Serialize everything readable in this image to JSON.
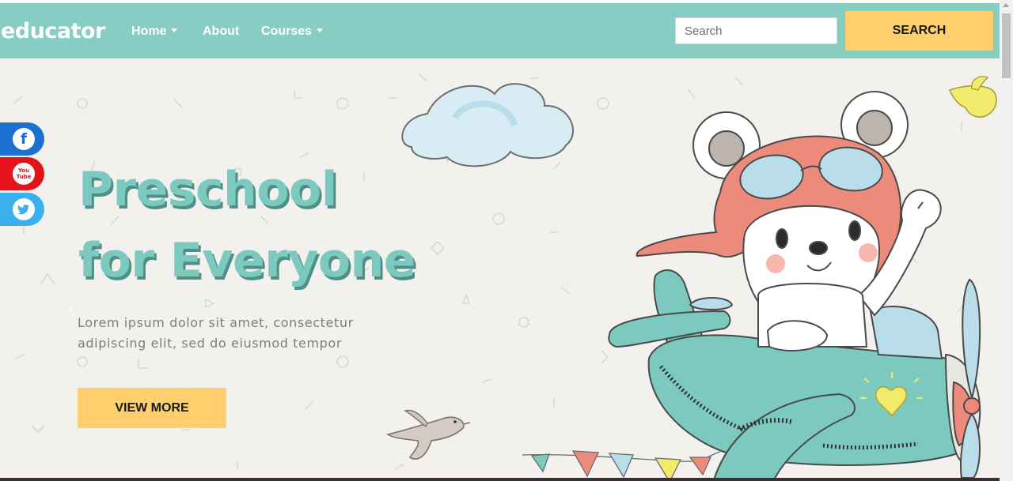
{
  "brand": {
    "name": "educator"
  },
  "nav": {
    "items": [
      {
        "label": "Home",
        "has_dropdown": true
      },
      {
        "label": "About",
        "has_dropdown": false
      },
      {
        "label": "Courses",
        "has_dropdown": true
      }
    ]
  },
  "search": {
    "placeholder": "Search",
    "value": "",
    "button_label": "SEARCH"
  },
  "hero": {
    "title_line1": "Preschool",
    "title_line2": "for Everyone",
    "subtitle": "Lorem ipsum dolor sit amet, consectetur adipiscing elit, sed do eiusmod tempor",
    "cta_label": "VIEW MORE",
    "prev_arrow": "‹"
  },
  "social": [
    {
      "name": "facebook",
      "icon": "facebook-icon",
      "glyph": "f",
      "color": "#1d6fd0"
    },
    {
      "name": "youtube",
      "icon": "youtube-icon",
      "glyph": "You Tube",
      "color": "#e4131a"
    },
    {
      "name": "twitter",
      "icon": "twitter-icon",
      "glyph": "",
      "color": "#3bb0ee"
    }
  ],
  "colors": {
    "navbar": "#87cdc3",
    "accent_button": "#fecf6c",
    "hero_background": "#f3f1ee",
    "title": "#7ccabf",
    "title_shadow": "#4f8f86"
  }
}
